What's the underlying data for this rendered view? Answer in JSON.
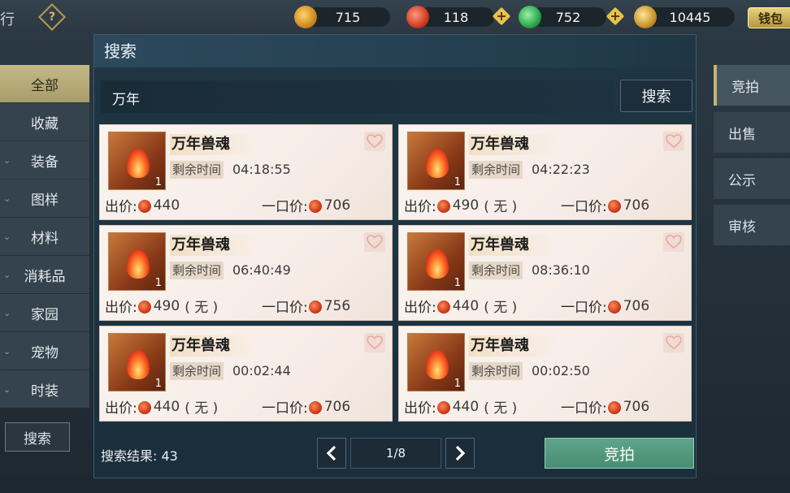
{
  "topbar": {
    "left_label": "行",
    "help_symbol": "?",
    "currencies": [
      {
        "icon": "gold-ingot-icon",
        "value": "715"
      },
      {
        "icon": "red-swirl-coin-icon",
        "value": "118"
      },
      {
        "icon": "jade-dragon-icon",
        "value": "752"
      },
      {
        "icon": "gold-leaf-icon",
        "value": "10445"
      }
    ],
    "wallet_label": "钱包"
  },
  "sidebar": {
    "items": [
      {
        "label": "全部",
        "active": true
      },
      {
        "label": "收藏"
      },
      {
        "label": "装备"
      },
      {
        "label": "图样"
      },
      {
        "label": "材料"
      },
      {
        "label": "消耗品"
      },
      {
        "label": "家园"
      },
      {
        "label": "宠物"
      },
      {
        "label": "时装"
      }
    ],
    "search_label": "搜索"
  },
  "right_tabs": [
    "竞拍",
    "出售",
    "公示",
    "审核"
  ],
  "dialog": {
    "title": "搜索",
    "query": "万年",
    "search_button": "搜索",
    "labels": {
      "time": "剩余时间",
      "bid": "出价:",
      "buyout": "一口价:"
    },
    "cards": [
      {
        "name": "万年兽魂",
        "qty": "1",
        "time": "04:18:55",
        "bid": "440",
        "bid_extra": "",
        "buyout": "706"
      },
      {
        "name": "万年兽魂",
        "qty": "1",
        "time": "04:22:23",
        "bid": "490",
        "bid_extra": "( 无 )",
        "buyout": "706"
      },
      {
        "name": "万年兽魂",
        "qty": "1",
        "time": "06:40:49",
        "bid": "490",
        "bid_extra": "( 无 )",
        "buyout": "756"
      },
      {
        "name": "万年兽魂",
        "qty": "1",
        "time": "08:36:10",
        "bid": "440",
        "bid_extra": "( 无 )",
        "buyout": "706"
      },
      {
        "name": "万年兽魂",
        "qty": "1",
        "time": "00:02:44",
        "bid": "440",
        "bid_extra": "( 无 )",
        "buyout": "706"
      },
      {
        "name": "万年兽魂",
        "qty": "1",
        "time": "00:02:50",
        "bid": "440",
        "bid_extra": "( 无 )",
        "buyout": "706"
      }
    ],
    "result_label": "搜索结果:",
    "result_count": "43",
    "page": "1/8",
    "bid_button": "竞拍"
  },
  "colors": {
    "accent_gold": "#c8b072",
    "bid_button": "#5fa48c",
    "card_bg": "#faf3ee"
  }
}
